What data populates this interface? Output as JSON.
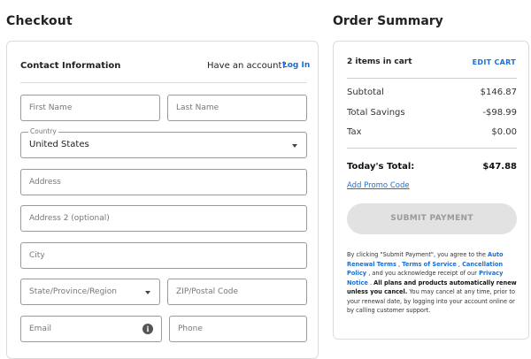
{
  "checkout": {
    "title": "Checkout",
    "contact_header": "Contact Information",
    "have_account": "Have an account?",
    "login_label": "Log In",
    "fields": {
      "first_name": "First Name",
      "last_name": "Last Name",
      "country_label": "Country",
      "country_value": "United States",
      "address": "Address",
      "address2": "Address 2 (optional)",
      "city": "City",
      "state": "State/Province/Region",
      "zip": "ZIP/Postal Code",
      "email": "Email",
      "phone": "Phone"
    }
  },
  "summary": {
    "title": "Order Summary",
    "items_in_cart": "2 items in cart",
    "edit_cart": "EDIT CART",
    "subtotal_label": "Subtotal",
    "subtotal_value": "$146.87",
    "savings_label": "Total Savings",
    "savings_value": "-$98.99",
    "tax_label": "Tax",
    "tax_value": "$0.00",
    "total_label": "Today's Total:",
    "total_value": "$47.88",
    "promo_label": "Add Promo Code",
    "submit_label": "SUBMIT PAYMENT",
    "legal": {
      "p1": "By clicking \"Submit Payment\", you agree to the ",
      "auto_renewal": "Auto Renewal Terms",
      "sep1": " , ",
      "tos": "Terms of Service",
      "sep2": " , ",
      "cancellation": "Cancellation Policy",
      "p2": " , and you acknowledge receipt of our ",
      "privacy": "Privacy Notice",
      "p3": " . ",
      "bold": "All plans and products automatically renew unless you cancel.",
      "p4": " You may cancel at any time, prior to your renewal date, by logging into your account online or by calling customer support."
    }
  },
  "colors": {
    "link": "#1a6fd6",
    "button_disabled_bg": "#e2e2e2",
    "button_disabled_text": "#9a9a9a"
  },
  "icons": {
    "info": "info-icon",
    "dropdown": "chevron-down-icon"
  }
}
